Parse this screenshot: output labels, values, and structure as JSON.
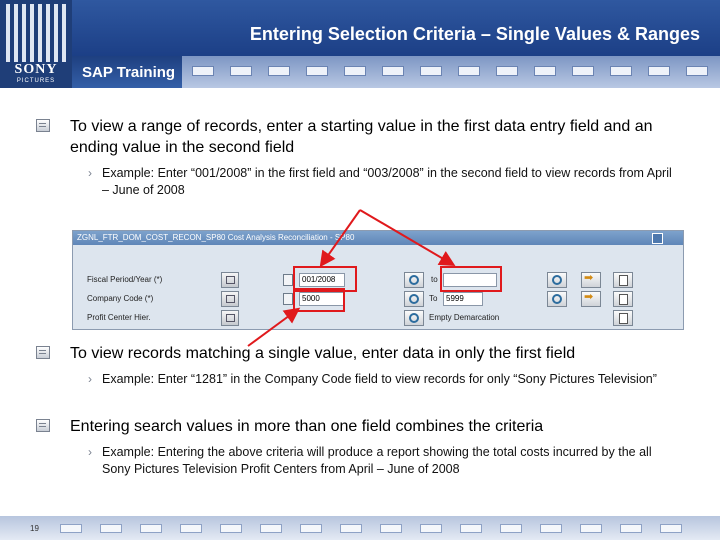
{
  "header": {
    "logo": "SONY",
    "logo_sub": "PICTURES",
    "brand": "SAP Training",
    "title": "Entering Selection Criteria – Single Values & Ranges"
  },
  "bullets": [
    {
      "text": "To view a range of records, enter a starting value in the first data entry field and an ending value in the second field",
      "sub": "Example: Enter “001/2008” in the first field and “003/2008” in the second field to view records from April – June of 2008"
    },
    {
      "text": "To view records matching a single value, enter data in only the first field",
      "sub": "Example: Enter “1281” in the Company Code field to view records for only “Sony Pictures Television”"
    },
    {
      "text": "Entering search values in more than one field combines the criteria",
      "sub": "Example: Entering the above criteria will produce a report showing the total costs incurred by the all Sony Pictures Television Profit Centers from April – June of 2008"
    }
  ],
  "sap_screen": {
    "title": "ZGNL_FTR_DOM_COST_RECON_SP80 Cost Analysis Reconciliation - SP80",
    "rows": [
      {
        "label": "Fiscal Period/Year (*)",
        "from_value": "001/2008",
        "to_label": "to",
        "to_value": ""
      },
      {
        "label": "Company Code (*)",
        "from_value": "5000",
        "to_label": "To",
        "to_value": "5999"
      },
      {
        "label": "Profit Center Hier.",
        "from_value": "",
        "to_label": "Empty Demarcation",
        "to_value": ""
      }
    ]
  },
  "footer": {
    "page": "19"
  },
  "colors": {
    "accent_red": "#e0191c",
    "header_blue": "#1c3f86"
  }
}
